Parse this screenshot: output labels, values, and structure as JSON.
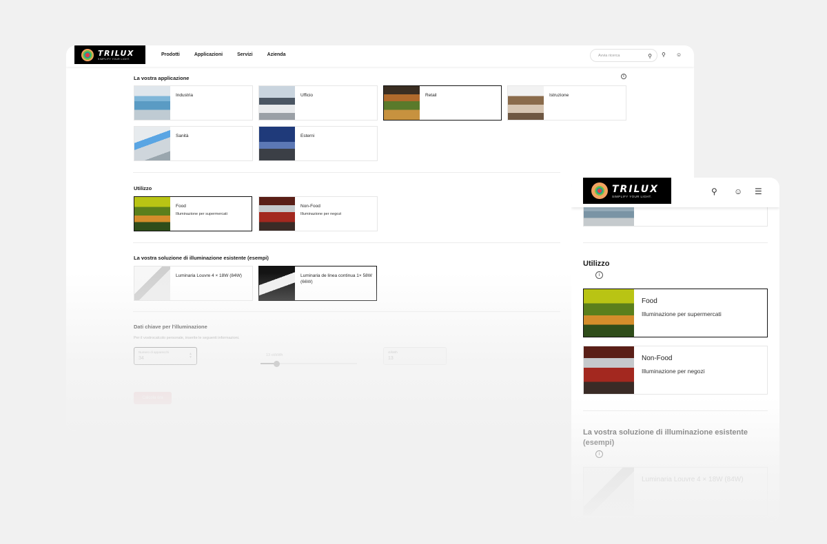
{
  "desktop": {
    "logo": {
      "brand": "TRILUX",
      "tagline": "SIMPLIFY YOUR LIGHT."
    },
    "nav": [
      "Prodotti",
      "Applicazioni",
      "Servizi",
      "Azienda"
    ],
    "search_placeholder": "Avvia ricerca",
    "sections": {
      "applicazione": {
        "title": "La vostra applicazione",
        "items": [
          {
            "label": "Industria",
            "selected": false
          },
          {
            "label": "Ufficio",
            "selected": false
          },
          {
            "label": "Retail",
            "selected": true
          },
          {
            "label": "Istruzione",
            "selected": false
          },
          {
            "label": "Sanità",
            "selected": false
          },
          {
            "label": "Esterni",
            "selected": false
          }
        ]
      },
      "utilizzo": {
        "title": "Utilizzo",
        "items": [
          {
            "label": "Food",
            "sub": "Illuminazione per supermercati",
            "selected": true
          },
          {
            "label": "Non-Food",
            "sub": "Illuminazione per negozi",
            "selected": false
          }
        ]
      },
      "soluzione": {
        "title": "La vostra soluzione di illuminazione esistente (esempi)",
        "items": [
          {
            "label": "Luminaria Louvre 4 × 18W (84W)",
            "selected": false
          },
          {
            "label": "Luminaria de linea continua 1× 58W (66W)",
            "selected": true
          }
        ]
      },
      "dati": {
        "title": "Dati chiave per l'illuminazione",
        "subtitle": "Per il vostrocalcolo personale, inserite le seguenti informazioni.",
        "apparecchi_label": "Numero di apparecchi",
        "apparecchi_value": "34",
        "slider_label": "13 ct/kWh",
        "slider_fraction": 0.17,
        "ctkwh_label": "ct/kWh",
        "ctkwh_value": "13",
        "button": "Calcola ora"
      }
    }
  },
  "mobile": {
    "logo": {
      "brand": "TRILUX",
      "tagline": "SIMPLIFY YOUR LIGHT."
    },
    "utilizzo_title": "Utilizzo",
    "utilizzo_items": [
      {
        "label": "Food",
        "sub": "Illuminazione per supermercati",
        "selected": true
      },
      {
        "label": "Non-Food",
        "sub": "Illuminazione per negozi",
        "selected": false
      }
    ],
    "soluzione_title": "La vostra soluzione di illuminazione esistente (esempi)",
    "soluzione_first": "Luminaria Louvre 4 × 18W (84W)"
  },
  "icons": {
    "search": "search-icon",
    "bell": "notification-icon",
    "user": "user-icon",
    "menu": "hamburger-menu-icon",
    "info": "info-icon"
  },
  "colors": {
    "selected_border": "#111111",
    "cta_button": "#e8a0a6",
    "logo_bg": "#000000"
  }
}
